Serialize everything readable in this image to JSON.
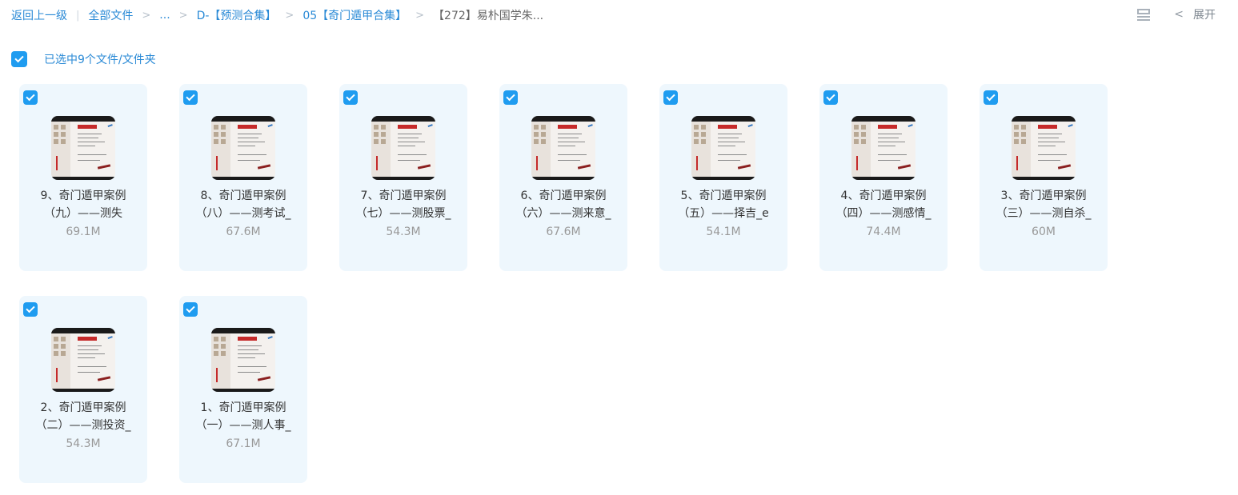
{
  "breadcrumb": {
    "back": "返回上一级",
    "all_files": "全部文件",
    "ellipsis": "...",
    "level1": "D-【预测合集】",
    "level2": "05【奇门遁甲合集】",
    "current": "【272】易朴国学朱..."
  },
  "toolbar": {
    "list_icon": "list-view-icon",
    "expand_label": "展开"
  },
  "selection": {
    "label": "已选中9个文件/文件夹",
    "checked": true
  },
  "colors": {
    "accent": "#1f9cf0",
    "link": "#2a8ad6",
    "card_bg": "#eef7fd"
  },
  "files": [
    {
      "line1": "9、奇门遁甲案例",
      "line2": "（九）——测失",
      "size": "69.1M"
    },
    {
      "line1": "8、奇门遁甲案例",
      "line2": "（八）——测考试_",
      "size": "67.6M"
    },
    {
      "line1": "7、奇门遁甲案例",
      "line2": "（七）——测股票_",
      "size": "54.3M"
    },
    {
      "line1": "6、奇门遁甲案例",
      "line2": "（六）——测来意_",
      "size": "67.6M"
    },
    {
      "line1": "5、奇门遁甲案例",
      "line2": "（五）——择吉_e",
      "size": "54.1M"
    },
    {
      "line1": "4、奇门遁甲案例",
      "line2": "（四）——测感情_",
      "size": "74.4M"
    },
    {
      "line1": "3、奇门遁甲案例",
      "line2": "（三）——测自杀_",
      "size": "60M"
    },
    {
      "line1": "2、奇门遁甲案例",
      "line2": "（二）——测投资_",
      "size": "54.3M"
    },
    {
      "line1": "1、奇门遁甲案例",
      "line2": "（一）——测人事_",
      "size": "67.1M"
    }
  ]
}
